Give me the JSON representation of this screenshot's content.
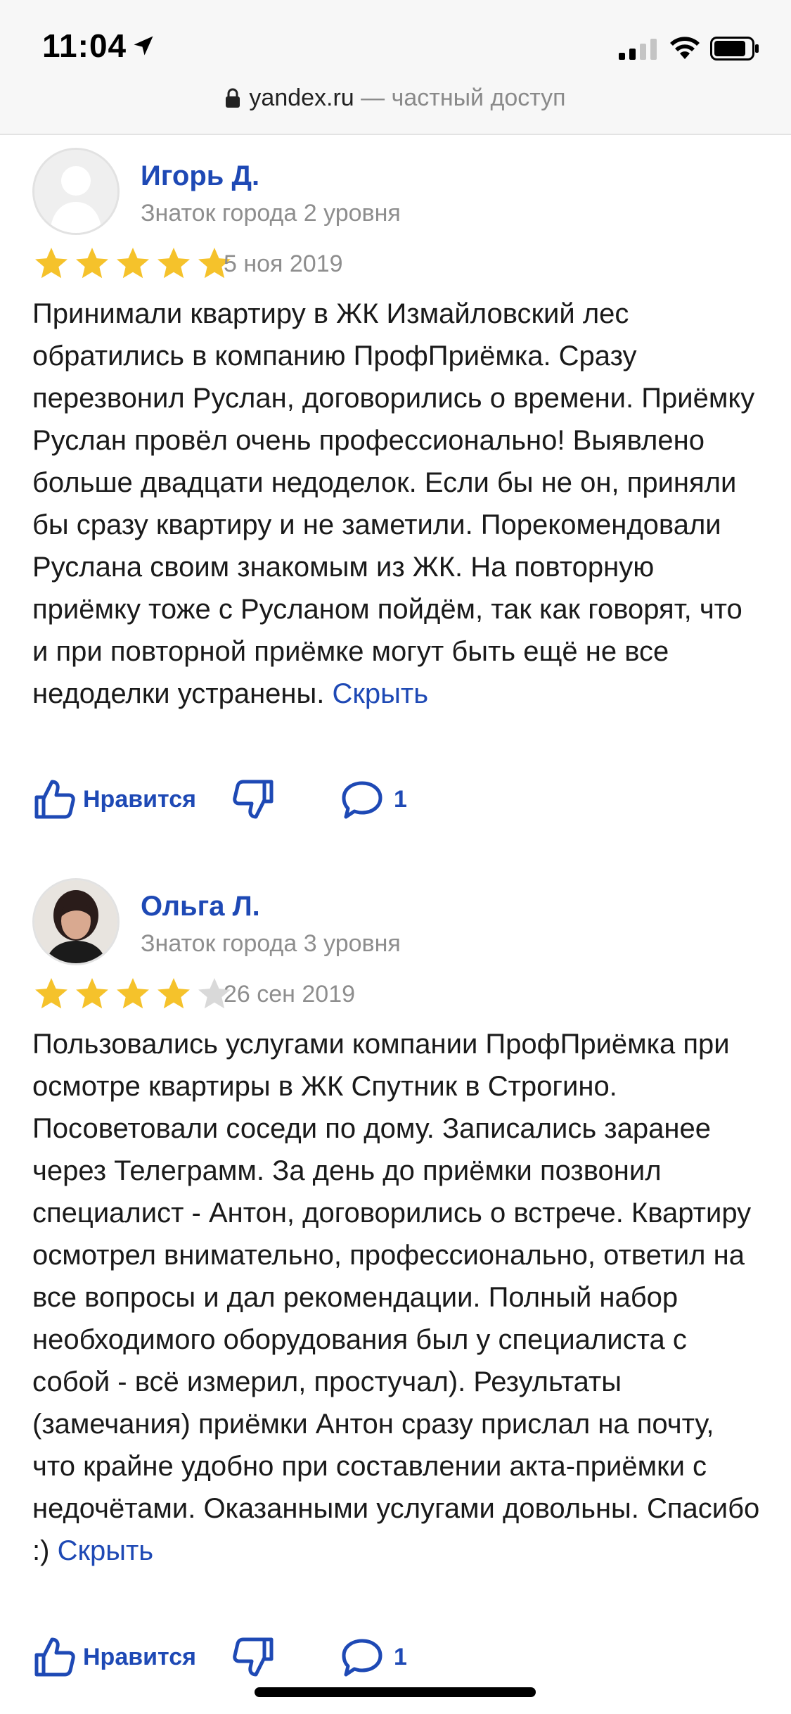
{
  "status_bar": {
    "time": "11:04",
    "icons": [
      "location-arrow-icon",
      "cellular-signal-icon",
      "wifi-icon",
      "battery-icon"
    ]
  },
  "address_bar": {
    "domain": "yandex.ru",
    "suffix": " — частный доступ",
    "icon": "lock-icon"
  },
  "colors": {
    "link": "#1e49b5",
    "star": "#f5c22b",
    "star_empty": "#d9d9d9",
    "muted_text": "#8e8e8e"
  },
  "reviews": [
    {
      "author": "Игорь Д.",
      "level": "Знаток города 2 уровня",
      "rating": 5,
      "date": "5 ноя 2019",
      "text": "Принимали квартиру в ЖК Измайловский лес обратились в компанию ПрофПриёмка. Сразу перезвонил Руслан, договорились о времени. Приёмку Руслан провёл очень профессионально! Выявлено больше двадцати недоделок. Если бы не он, приняли бы сразу квартиру и не заметили. Порекомендовали Руслана своим знакомым из ЖК. На повторную приёмку тоже с Русланом пойдём, так как говорят, что и при повторной приёмке могут быть ещё не все недоделки устранены.",
      "hide_label": "Скрыть",
      "like_label": "Нравится",
      "comment_count": "1"
    },
    {
      "author": "Ольга Л.",
      "level": "Знаток города 3 уровня",
      "rating": 4,
      "date": "26 сен 2019",
      "text": "Пользовались услугами компании ПрофПриёмка при осмотре квартиры в ЖК Спутник в Строгино. Посоветовали соседи по дому. Записались заранее через Телеграмм. За день до приёмки позвонил специалист - Антон, договорились о встрече. Квартиру осмотрел внимательно, профессионально, ответил на все вопросы и дал рекомендации. Полный набор необходимого оборудования был у специалиста с собой - всё измерил, простучал). Результаты (замечания) приёмки Антон сразу прислал на почту, что крайне удобно при составлении акта-приёмки с недочётами. Оказанными услугами довольны. Спасибо :)",
      "hide_label": "Скрыть",
      "like_label": "Нравится",
      "comment_count": "1"
    }
  ]
}
